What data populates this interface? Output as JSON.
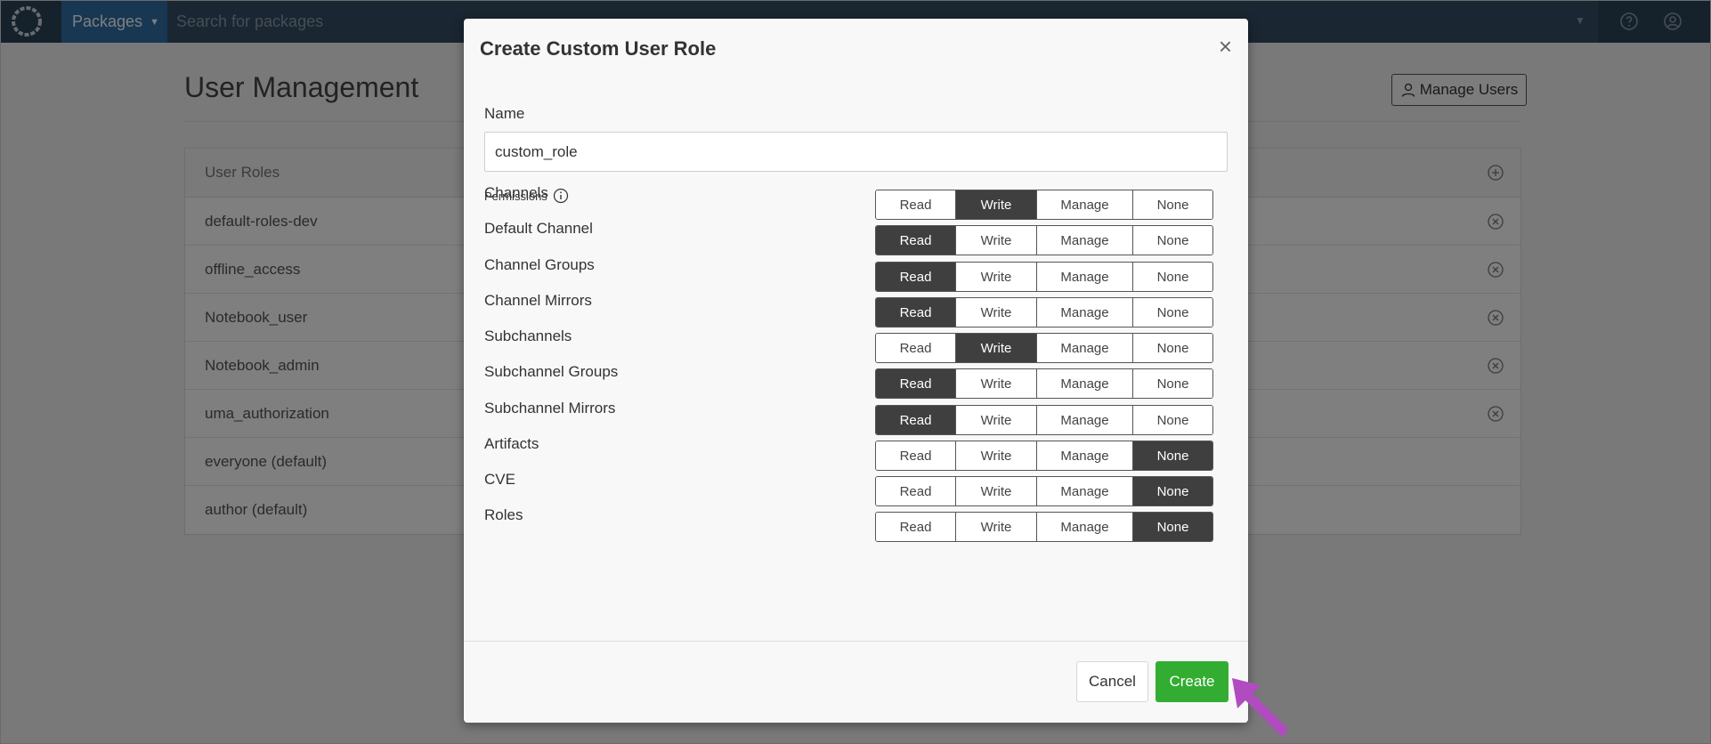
{
  "topbar": {
    "packages_label": "Packages",
    "search_placeholder": "Search for packages"
  },
  "page": {
    "title": "User Management",
    "manage_users_label": "Manage Users"
  },
  "roles_table": {
    "header": "User Roles",
    "rows": [
      {
        "name": "default-roles-dev",
        "removable": true
      },
      {
        "name": "offline_access",
        "removable": true
      },
      {
        "name": "Notebook_user",
        "removable": true
      },
      {
        "name": "Notebook_admin",
        "removable": true
      },
      {
        "name": "uma_authorization",
        "removable": true
      },
      {
        "name": "everyone (default)",
        "removable": false
      },
      {
        "name": "author (default)",
        "removable": false
      }
    ]
  },
  "modal": {
    "title": "Create Custom User Role",
    "close_glyph": "×",
    "name_label": "Name",
    "name_value": "custom_role",
    "permissions_label": "Permissions",
    "options": [
      "Read",
      "Write",
      "Manage",
      "None"
    ],
    "permissions": [
      {
        "name": "Channels",
        "selected": "Write"
      },
      {
        "name": "Default Channel",
        "selected": "Read"
      },
      {
        "name": "Channel Groups",
        "selected": "Read"
      },
      {
        "name": "Channel Mirrors",
        "selected": "Read"
      },
      {
        "name": "Subchannels",
        "selected": "Write"
      },
      {
        "name": "Subchannel Groups",
        "selected": "Read"
      },
      {
        "name": "Subchannel Mirrors",
        "selected": "Read"
      },
      {
        "name": "Artifacts",
        "selected": "None"
      },
      {
        "name": "CVE",
        "selected": "None"
      },
      {
        "name": "Roles",
        "selected": "None"
      }
    ],
    "cancel_label": "Cancel",
    "create_label": "Create"
  },
  "colors": {
    "topbar": "#2b4257",
    "accent_blue": "#2f6fa5",
    "create_green": "#32ad32",
    "segment_active": "#3f3f3f",
    "pointer_arrow": "#b04cc0"
  },
  "icons": {
    "logo": "app-logo-icon",
    "help": "help-icon",
    "user": "user-circle-icon",
    "add": "add-circle-icon",
    "remove": "remove-circle-icon",
    "info": "info-icon",
    "pointer": "pointer-arrow-icon"
  }
}
